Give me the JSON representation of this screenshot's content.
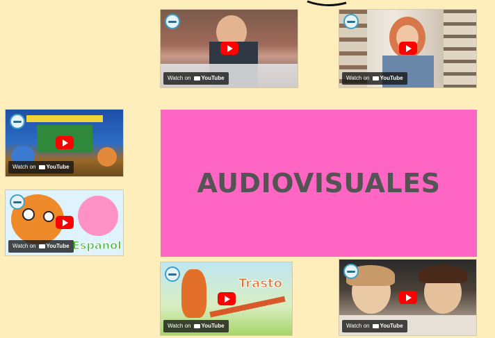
{
  "page": {
    "background": "#fdeebc"
  },
  "banner": {
    "title": "AUDIOVISUALES",
    "color": "#ff66c4",
    "text_color": "#545454"
  },
  "videos": [
    {
      "watch_label": "Watch on",
      "yt_label": "YouTube",
      "overlay": ""
    },
    {
      "watch_label": "Watch on",
      "yt_label": "YouTube",
      "overlay": ""
    },
    {
      "watch_label": "Watch on",
      "yt_label": "YouTube",
      "overlay": ""
    },
    {
      "watch_label": "Watch on",
      "yt_label": "YouTube",
      "overlay": "Español"
    },
    {
      "watch_label": "Watch on",
      "yt_label": "YouTube",
      "overlay": "Trasto"
    },
    {
      "watch_label": "Watch on",
      "yt_label": "YouTube",
      "overlay": ""
    }
  ],
  "icons": {
    "play": "youtube-play-icon",
    "channel": "channel-logo-icon"
  }
}
